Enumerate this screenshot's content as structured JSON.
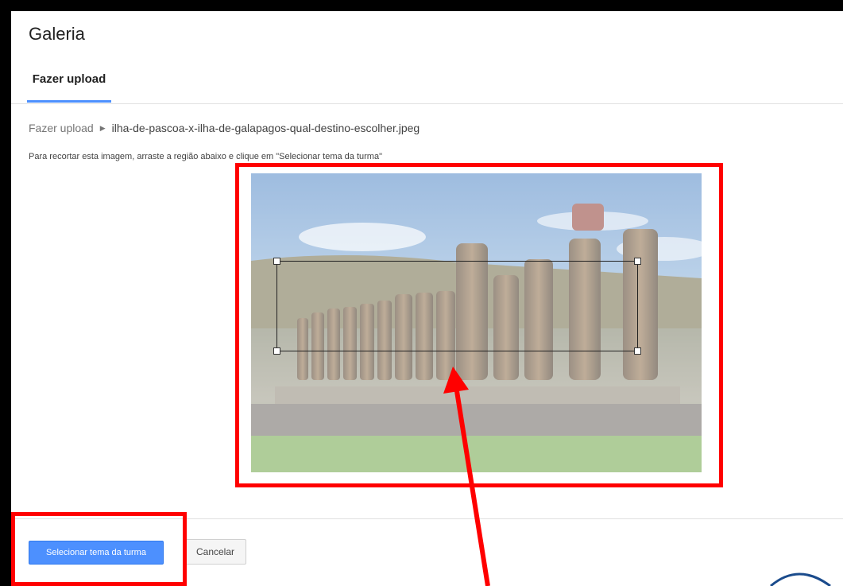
{
  "dialog": {
    "title": "Galeria",
    "tab": "Fazer upload"
  },
  "breadcrumb": {
    "root": "Fazer upload",
    "separator_icon": "triangle-right-icon",
    "file": "ilha-de-pascoa-x-ilha-de-galapagos-qual-destino-escolher.jpeg"
  },
  "instructions": "Para recortar esta imagem, arraste a região abaixo e clique em \"Selecionar tema da turma\"",
  "footer": {
    "primary_button": "Selecionar tema da turma",
    "secondary_button": "Cancelar"
  },
  "colors": {
    "accent": "#4d90fe",
    "annotation": "#ff0000"
  }
}
